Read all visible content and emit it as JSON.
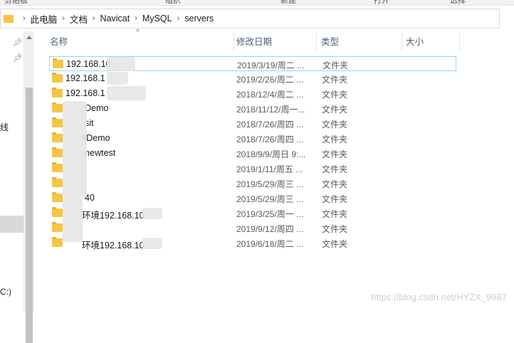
{
  "ribbon": {
    "items": [
      "剪贴板",
      "组织",
      "新建",
      "打开",
      "选择"
    ]
  },
  "address_bar": {
    "crumbs": [
      "此电脑",
      "文档",
      "Navicat",
      "MySQL",
      "servers"
    ]
  },
  "columns": {
    "name": "名称",
    "date": "修改日期",
    "type": "类型",
    "size": "大小"
  },
  "nav": {
    "partial_char": "线",
    "drive_label": "C:)"
  },
  "files": [
    {
      "name": "192.168.10",
      "date": "2019/3/19/周二 ...",
      "type": "文件夹"
    },
    {
      "name": "192.168.1",
      "date": "2019/2/26/周二 ...",
      "type": "文件夹"
    },
    {
      "name": "192.168.1",
      "date": "2018/12/4/周二 ...",
      "type": "文件夹"
    },
    {
      "name": "Demo",
      "date": "2018/11/12/周一...",
      "type": "文件夹"
    },
    {
      "name": "sit",
      "date": "2018/7/26/周四 ...",
      "type": "文件夹"
    },
    {
      "name": "lfDemo",
      "date": "2018/7/26/周四 ...",
      "type": "文件夹"
    },
    {
      "name": "-newtest",
      "date": "2018/9/9/周日 9:...",
      "type": "文件夹"
    },
    {
      "name": "",
      "date": "2019/1/11/周五 ...",
      "type": "文件夹"
    },
    {
      "name": "",
      "date": "2019/5/29/周三 ...",
      "type": "文件夹"
    },
    {
      "name": "40",
      "date": "2019/5/29/周三 ...",
      "type": "文件夹"
    },
    {
      "name": "环境192.168.10",
      "date": "2019/3/25/周一 ...",
      "type": "文件夹"
    },
    {
      "name": "",
      "date": "2019/9/12/周四 ...",
      "type": "文件夹"
    },
    {
      "name": "环境192.168.10",
      "date": "2019/6/18/周二 ...",
      "type": "文件夹"
    }
  ],
  "watermark": "https://blog.csdn.net/HYZX_9987"
}
